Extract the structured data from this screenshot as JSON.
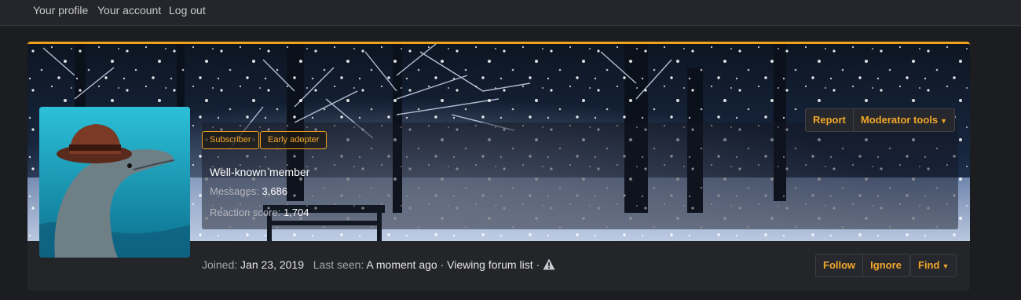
{
  "topnav": {
    "links": [
      "Your profile",
      "Your account",
      "Log out"
    ]
  },
  "profile": {
    "badges": [
      "Subscriber",
      "Early adopter"
    ],
    "member_title": "Well-known member",
    "messages_label": "Messages:",
    "messages_value": "3,686",
    "reaction_label": "Reaction score:",
    "reaction_value": "1,704",
    "joined_label": "Joined:",
    "joined_value": "Jan 23, 2019",
    "last_seen_label": "Last seen:",
    "last_seen_value": "A moment ago · Viewing forum list ·"
  },
  "actions": {
    "report": "Report",
    "moderator_tools": "Moderator tools",
    "follow": "Follow",
    "ignore": "Ignore",
    "find": "Find"
  },
  "colors": {
    "accent": "#f0a11a",
    "background": "#1c1d20",
    "card": "#242529"
  },
  "icons": {
    "warning": "warning-triangle-icon",
    "dropdown": "caret-down-icon"
  }
}
